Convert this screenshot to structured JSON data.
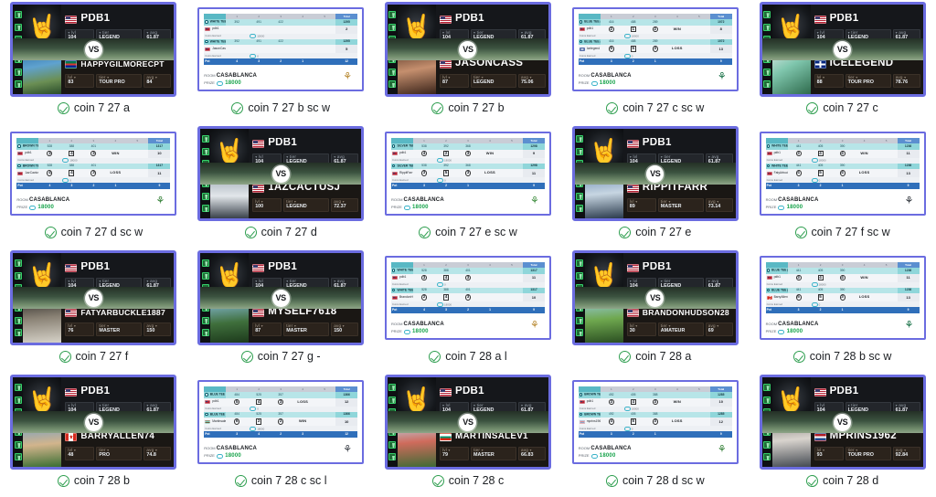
{
  "page": {
    "background": "#ffffff",
    "accent_border": "#6b6ce0",
    "check_color": "#2e9e4f",
    "grid_columns": 5,
    "grid_rows": 4
  },
  "labels": {
    "vs": "VS",
    "lvl": "lvl",
    "tier": "tier",
    "avg": "avg",
    "room": "ROOM",
    "prize": "PRIZE",
    "room_name": "CASABLANCA",
    "prize_value": "18000",
    "win": "WIN",
    "loss": "LOSS",
    "pot": "Pot",
    "total": "Total",
    "coin_earned": "Coins Earned"
  },
  "items": [
    {
      "caption": "coin 7 27 a",
      "type": "vs",
      "top": {
        "name": "PDB1",
        "flag": "us",
        "lvl": "104",
        "tier": "LEGEND",
        "avg": "61.87",
        "avatar": "skull"
      },
      "bottom": {
        "name": "HAPPYGILMORECPT",
        "flag": "za",
        "lvl": "83",
        "tier": "TOUR PRO",
        "avg": "84",
        "avatar": "photo-a"
      }
    },
    {
      "caption": "coin 7 27 b sc w",
      "type": "scorecard",
      "logo": "logo-crossed",
      "holes": [
        "1",
        "2",
        "3",
        "4",
        "5"
      ],
      "rows": [
        {
          "kind": "course",
          "label": "WHITE TEE (3 HOLES)",
          "nums": [
            "392",
            "491",
            "422"
          ],
          "total": "1295"
        },
        {
          "kind": "player",
          "flag": "us",
          "name": "pdb1",
          "nums": [
            "",
            "",
            ""
          ],
          "result": "",
          "total": "2"
        },
        {
          "kind": "coin",
          "label": "Coins Earned",
          "value": "10000"
        },
        {
          "kind": "course",
          "label": "WHITE TEE (3 HOLES)",
          "nums": [
            "392",
            "491",
            "422"
          ],
          "total": "1295"
        },
        {
          "kind": "player",
          "flag": "us",
          "name": "JasonCass",
          "nums": [
            "",
            "",
            ""
          ],
          "result": "",
          "total": "5"
        },
        {
          "kind": "coin",
          "label": "Coins Earned",
          "value": "0"
        },
        {
          "kind": "pot",
          "label": "Pot",
          "nums": [
            "4",
            "3",
            "2",
            "1",
            ""
          ],
          "total": "12"
        }
      ]
    },
    {
      "caption": "coin 7 27 b",
      "type": "vs",
      "top": {
        "name": "PDB1",
        "flag": "us",
        "lvl": "104",
        "tier": "LEGEND",
        "avg": "61.87",
        "avatar": "skull"
      },
      "bottom": {
        "name": "JASONCASS",
        "flag": "us",
        "lvl": "87",
        "tier": "LEGEND",
        "avg": "75.06",
        "avatar": "photo-b"
      }
    },
    {
      "caption": "coin 7 27 c sc w",
      "type": "scorecard",
      "logo": "logo-green",
      "holes": [
        "1",
        "2",
        "3",
        "4",
        "5"
      ],
      "rows": [
        {
          "kind": "course",
          "label": "BLUE TEE (3 HOLES)",
          "nums": [
            "416",
            "488",
            "289"
          ],
          "total": "1072"
        },
        {
          "kind": "player",
          "flag": "us",
          "name": "pdb1",
          "nums": [
            "2",
            "1",
            "2"
          ],
          "result": "WIN",
          "total": "8"
        },
        {
          "kind": "coin",
          "label": "Coins Earned",
          "value": "18000"
        },
        {
          "kind": "course",
          "label": "BLUE TEE (3 HOLES)",
          "nums": [
            "416",
            "488",
            "289"
          ],
          "total": "1072"
        },
        {
          "kind": "player",
          "flag": "gb",
          "name": "Icelegend",
          "nums": [
            "5",
            "5",
            "3"
          ],
          "result": "LOSS",
          "total": "13"
        },
        {
          "kind": "coin",
          "label": "Coins Earned",
          "value": "0"
        },
        {
          "kind": "pot",
          "label": "Pot",
          "nums": [
            "3",
            "2",
            "1",
            "",
            ""
          ],
          "total": "9"
        }
      ]
    },
    {
      "caption": "coin 7 27 c",
      "type": "vs",
      "top": {
        "name": "PDB1",
        "flag": "us",
        "lvl": "104",
        "tier": "LEGEND",
        "avg": "61.87",
        "avatar": "skull"
      },
      "bottom": {
        "name": "ICELEGEND",
        "flag": "uk",
        "lvl": "88",
        "tier": "TOUR PRO",
        "avg": "78.76",
        "avatar": "photo-c"
      }
    },
    {
      "caption": "coin 7 27 d sc w",
      "type": "scorecard",
      "logo": "logo-tree",
      "holes": [
        "1",
        "2",
        "3",
        "4",
        "5"
      ],
      "rows": [
        {
          "kind": "course",
          "label": "BROWN TEE (3 HOLES)",
          "nums": [
            "528",
            "388",
            "401"
          ],
          "total": "1317"
        },
        {
          "kind": "player",
          "flag": "us",
          "name": "pdb1",
          "nums": [
            "3",
            "4",
            "3"
          ],
          "result": "WIN",
          "total": "10"
        },
        {
          "kind": "coin",
          "label": "Coins Earned",
          "value": "18000"
        },
        {
          "kind": "course",
          "label": "BROWN TEE (3 HOLES)",
          "nums": [
            "528",
            "388",
            "401"
          ],
          "total": "1317"
        },
        {
          "kind": "player",
          "flag": "us",
          "name": "1azCactusJ",
          "nums": [
            "4",
            "4",
            "3"
          ],
          "result": "LOSS",
          "total": "11"
        },
        {
          "kind": "coin",
          "label": "Coins Earned",
          "value": "0"
        },
        {
          "kind": "pot",
          "label": "Pot",
          "nums": [
            "4",
            "3",
            "2",
            "1",
            ""
          ],
          "total": "9"
        }
      ]
    },
    {
      "caption": "coin 7 27 d",
      "type": "vs",
      "top": {
        "name": "PDB1",
        "flag": "us",
        "lvl": "104",
        "tier": "LEGEND",
        "avg": "61.87",
        "avatar": "skull"
      },
      "bottom": {
        "name": "1AZCACTUSJ",
        "flag": "us",
        "lvl": "100",
        "tier": "LEGEND",
        "avg": "72.37",
        "avatar": "photo-d"
      }
    },
    {
      "caption": "coin 7 27 e sc w",
      "type": "scorecard",
      "logo": "logo-leaf",
      "holes": [
        "1",
        "2",
        "3",
        "4",
        "5"
      ],
      "rows": [
        {
          "kind": "course",
          "label": "SILVER TEE (3 HOLES)",
          "nums": [
            "538",
            "392",
            "368"
          ],
          "total": "1298"
        },
        {
          "kind": "player",
          "flag": "us",
          "name": "pdb1",
          "nums": [
            "4",
            "2",
            "3"
          ],
          "result": "WIN",
          "total": "9"
        },
        {
          "kind": "coin",
          "label": "Coins Earned",
          "value": "18000"
        },
        {
          "kind": "course",
          "label": "SILVER TEE (3 HOLES)",
          "nums": [
            "538",
            "392",
            "368"
          ],
          "total": "1298"
        },
        {
          "kind": "player",
          "flag": "us",
          "name": "RippitFarr",
          "nums": [
            "3",
            "5",
            "3"
          ],
          "result": "LOSS",
          "total": "11"
        },
        {
          "kind": "coin",
          "label": "Coins Earned",
          "value": "0"
        },
        {
          "kind": "pot",
          "label": "Pot",
          "nums": [
            "3",
            "2",
            "1",
            "",
            ""
          ],
          "total": "9"
        }
      ]
    },
    {
      "caption": "coin 7 27 e",
      "type": "vs",
      "top": {
        "name": "PDB1",
        "flag": "us",
        "lvl": "104",
        "tier": "LEGEND",
        "avg": "61.87",
        "avatar": "skull"
      },
      "bottom": {
        "name": "RIPPITFARR",
        "flag": "us",
        "lvl": "89",
        "tier": "MASTER",
        "avg": "73.14",
        "avatar": "photo-e"
      }
    },
    {
      "caption": "coin 7 27 f sc w",
      "type": "scorecard",
      "logo": "logo-dark",
      "holes": [
        "1",
        "2",
        "3",
        "4",
        "5"
      ],
      "rows": [
        {
          "kind": "course",
          "label": "WHITE TEE (3 HOLES)",
          "nums": [
            "441",
            "405",
            "390"
          ],
          "total": "1236"
        },
        {
          "kind": "player",
          "flag": "us",
          "name": "pdb1",
          "nums": [
            "3",
            "4",
            "4"
          ],
          "result": "WIN",
          "total": "11"
        },
        {
          "kind": "coin",
          "label": "Coins Earned",
          "value": "18000"
        },
        {
          "kind": "course",
          "label": "WHITE TEE (3 HOLES)",
          "nums": [
            "441",
            "405",
            "390"
          ],
          "total": "1236"
        },
        {
          "kind": "player",
          "flag": "us",
          "name": "FatyArbuckle1887",
          "nums": [
            "4",
            "5",
            "4"
          ],
          "result": "LOSS",
          "total": "13"
        },
        {
          "kind": "coin",
          "label": "Coins Earned",
          "value": "0"
        },
        {
          "kind": "pot",
          "label": "Pot",
          "nums": [
            "3",
            "2",
            "1",
            "",
            ""
          ],
          "total": "9"
        }
      ]
    },
    {
      "caption": "coin 7 27 f",
      "type": "vs",
      "top": {
        "name": "PDB1",
        "flag": "us",
        "lvl": "104",
        "tier": "LEGEND",
        "avg": "61.87",
        "avatar": "skull"
      },
      "bottom": {
        "name": "FATYARBUCKLE1887",
        "flag": "us",
        "lvl": "76",
        "tier": "MASTER",
        "avg": "150",
        "avatar": "photo-f"
      }
    },
    {
      "caption": "coin 7 27 g -",
      "type": "vs",
      "top": {
        "name": "PDB1",
        "flag": "us",
        "lvl": "104",
        "tier": "LEGEND",
        "avg": "61.87",
        "avatar": "skull"
      },
      "bottom": {
        "name": "MYSELF7618",
        "flag": "us",
        "lvl": "87",
        "tier": "MASTER",
        "avg": "150",
        "avatar": "photo-g"
      }
    },
    {
      "caption": "coin 7 28 a l",
      "type": "scorecard",
      "logo": "logo-crossed",
      "holes": [
        "1",
        "2",
        "3",
        "4",
        "5"
      ],
      "rows": [
        {
          "kind": "course",
          "label": "WHITE TEE (3 HOLES)",
          "nums": [
            "528",
            "388",
            "401"
          ],
          "total": "1317"
        },
        {
          "kind": "player",
          "flag": "us",
          "name": "pdb1",
          "nums": [
            "3",
            "4",
            "3"
          ],
          "result": "",
          "total": "11"
        },
        {
          "kind": "coin",
          "label": "Coins Earned",
          "value": "0"
        },
        {
          "kind": "course",
          "label": "WHITE TEE (3 HOLES)",
          "nums": [
            "528",
            "388",
            "401"
          ],
          "total": "1317"
        },
        {
          "kind": "player",
          "flag": "us",
          "name": "BrandonHudson28",
          "nums": [
            "2",
            "4",
            "3"
          ],
          "result": "",
          "total": "10"
        },
        {
          "kind": "coin",
          "label": "Coins Earned",
          "value": "18000"
        },
        {
          "kind": "pot",
          "label": "Pot",
          "nums": [
            "4",
            "3",
            "2",
            "1",
            ""
          ],
          "total": "9"
        }
      ]
    },
    {
      "caption": "coin 7 28 a",
      "type": "vs",
      "top": {
        "name": "PDB1",
        "flag": "us",
        "lvl": "104",
        "tier": "LEGEND",
        "avg": "61.87",
        "avatar": "skull"
      },
      "bottom": {
        "name": "BRANDONHUDSON28",
        "flag": "us",
        "lvl": "30",
        "tier": "AMATEUR",
        "avg": "69",
        "avatar": "photo-h"
      }
    },
    {
      "caption": "coin 7 28 b sc w",
      "type": "scorecard",
      "logo": "logo-green",
      "holes": [
        "1",
        "2",
        "3",
        "4",
        "5"
      ],
      "rows": [
        {
          "kind": "course",
          "label": "BLUE TEE (3 HOLES)",
          "nums": [
            "441",
            "405",
            "390"
          ],
          "total": "1236"
        },
        {
          "kind": "player",
          "flag": "us",
          "name": "pdb1",
          "nums": [
            "3",
            "4",
            "4"
          ],
          "result": "WIN",
          "total": "11"
        },
        {
          "kind": "coin",
          "label": "Coins Earned",
          "value": "18000"
        },
        {
          "kind": "course",
          "label": "BLUE TEE (3 HOLES)",
          "nums": [
            "441",
            "405",
            "390"
          ],
          "total": "1236"
        },
        {
          "kind": "player",
          "flag": "ca",
          "name": "BarryAllen74",
          "nums": [
            "5",
            "5",
            "3"
          ],
          "result": "LOSS",
          "total": "13"
        },
        {
          "kind": "coin",
          "label": "Coins Earned",
          "value": "0"
        },
        {
          "kind": "pot",
          "label": "Pot",
          "nums": [
            "3",
            "2",
            "1",
            "",
            ""
          ],
          "total": "9"
        }
      ]
    },
    {
      "caption": "coin 7 28 b",
      "type": "vs",
      "top": {
        "name": "PDB1",
        "flag": "us",
        "lvl": "104",
        "tier": "LEGEND",
        "avg": "61.87",
        "avatar": "skull"
      },
      "bottom": {
        "name": "BARRYALLEN74",
        "flag": "ca",
        "lvl": "48",
        "tier": "PRO",
        "avg": "74.8",
        "avatar": "photo-i"
      }
    },
    {
      "caption": "coin 7 28 c sc l",
      "type": "scorecard",
      "logo": "logo-anchor",
      "holes": [
        "1",
        "2",
        "3",
        "4",
        "5"
      ],
      "rows": [
        {
          "kind": "course",
          "label": "BLUE TEE (3 HOLES)",
          "nums": [
            "484",
            "525",
            "357"
          ],
          "total": "1366"
        },
        {
          "kind": "player",
          "flag": "us",
          "name": "pdb1",
          "nums": [
            "5",
            "4",
            "3"
          ],
          "result": "LOSS",
          "total": "12"
        },
        {
          "kind": "coin",
          "label": "Coins Earned",
          "value": "0"
        },
        {
          "kind": "course",
          "label": "BLUE TEE (3 HOLES)",
          "nums": [
            "484",
            "525",
            "357"
          ],
          "total": "1366"
        },
        {
          "kind": "player",
          "flag": "bg",
          "name": "MartinsaleV1",
          "nums": [
            "6",
            "2",
            "2"
          ],
          "result": "WIN",
          "total": "10"
        },
        {
          "kind": "coin",
          "label": "Coins Earned",
          "value": "18000"
        },
        {
          "kind": "pot",
          "label": "Pot",
          "nums": [
            "3",
            "4",
            "2",
            "3",
            ""
          ],
          "total": "12"
        }
      ]
    },
    {
      "caption": "coin 7 28 c",
      "type": "vs",
      "top": {
        "name": "PDB1",
        "flag": "us",
        "lvl": "104",
        "tier": "LEGEND",
        "avg": "61.87",
        "avatar": "skull"
      },
      "bottom": {
        "name": "MARTINSALEV1",
        "flag": "bg",
        "lvl": "79",
        "tier": "MASTER",
        "avg": "66.83",
        "avatar": "photo-j"
      }
    },
    {
      "caption": "coin 7 28 d sc w",
      "type": "scorecard",
      "logo": "logo-tree",
      "holes": [
        "1",
        "2",
        "3",
        "4",
        "5"
      ],
      "rows": [
        {
          "kind": "course",
          "label": "BROWN TEE (3 HOLES)",
          "nums": [
            "492",
            "405",
            "388"
          ],
          "total": "1285"
        },
        {
          "kind": "player",
          "flag": "us",
          "name": "pdb1",
          "nums": [
            "3",
            "4",
            "3"
          ],
          "result": "WIN",
          "total": "10"
        },
        {
          "kind": "coin",
          "label": "Coins Earned",
          "value": "18000"
        },
        {
          "kind": "course",
          "label": "BROWN TEE (3 HOLES)",
          "nums": [
            "492",
            "405",
            "388"
          ],
          "total": "1285"
        },
        {
          "kind": "player",
          "flag": "nl",
          "name": "mprins1962",
          "nums": [
            "4",
            "5",
            "3"
          ],
          "result": "LOSS",
          "total": "12"
        },
        {
          "kind": "coin",
          "label": "Coins Earned",
          "value": "0"
        },
        {
          "kind": "pot",
          "label": "Pot",
          "nums": [
            "3",
            "2",
            "1",
            "",
            ""
          ],
          "total": "9"
        }
      ]
    },
    {
      "caption": "coin 7 28 d",
      "type": "vs",
      "top": {
        "name": "PDB1",
        "flag": "us",
        "lvl": "104",
        "tier": "LEGEND",
        "avg": "61.87",
        "avatar": "skull"
      },
      "bottom": {
        "name": "MPRINS1962",
        "flag": "nl",
        "lvl": "93",
        "tier": "TOUR PRO",
        "avg": "92.84",
        "avatar": "photo-k"
      }
    }
  ]
}
